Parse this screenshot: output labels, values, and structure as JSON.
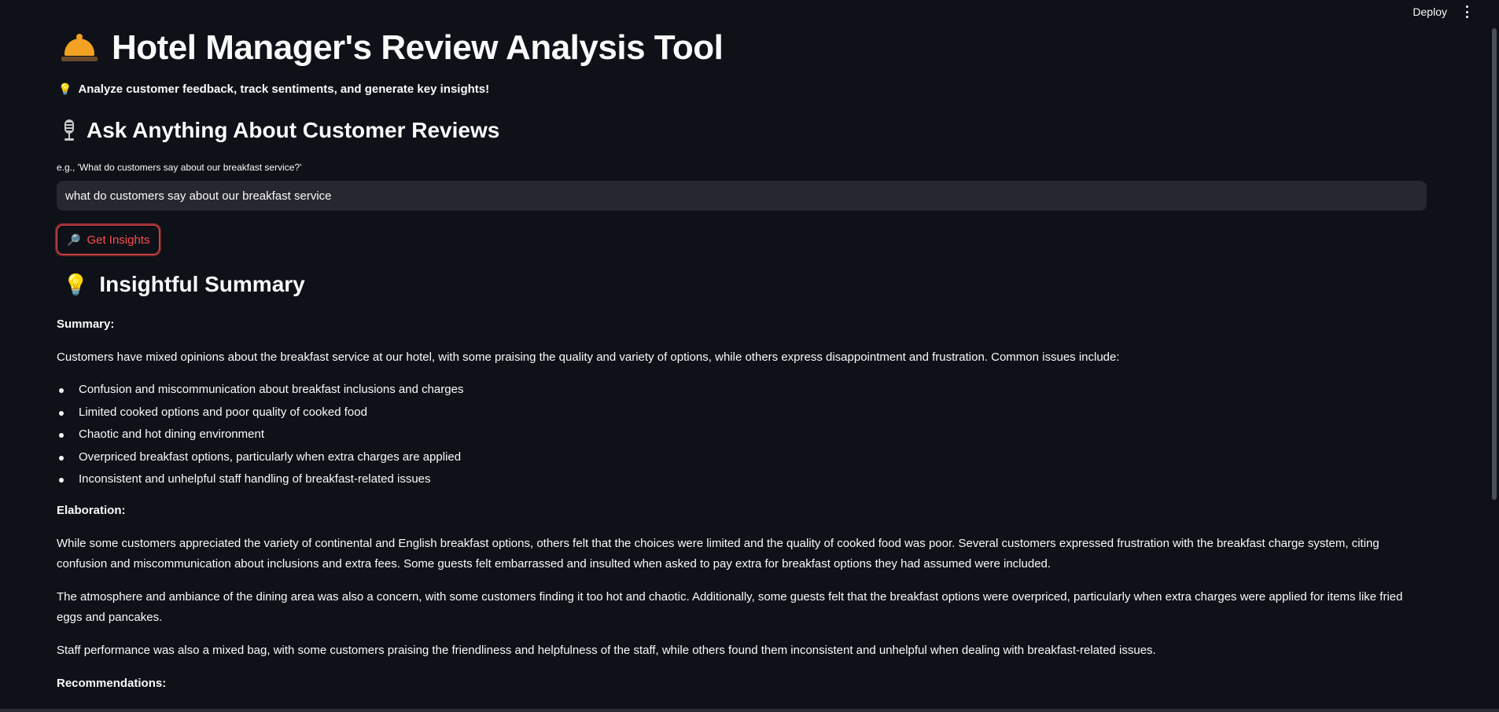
{
  "topbar": {
    "deploy_label": "Deploy"
  },
  "header": {
    "title": "Hotel Manager's Review Analysis Tool",
    "tagline": "Analyze customer feedback, track sentiments, and generate key insights!"
  },
  "ask": {
    "heading": "Ask Anything About Customer Reviews",
    "field_label": "e.g., 'What do customers say about our breakfast service?'",
    "input_value": "what do customers say about our breakfast service",
    "button_label": "Get Insights"
  },
  "summary": {
    "heading": "Insightful Summary",
    "summary_label": "Summary:",
    "intro": "Customers have mixed opinions about the breakfast service at our hotel, with some praising the quality and variety of options, while others express disappointment and frustration. Common issues include:",
    "issues": [
      "Confusion and miscommunication about breakfast inclusions and charges",
      "Limited cooked options and poor quality of cooked food",
      "Chaotic and hot dining environment",
      "Overpriced breakfast options, particularly when extra charges are applied",
      "Inconsistent and unhelpful staff handling of breakfast-related issues"
    ],
    "elaboration_label": "Elaboration:",
    "paragraphs": [
      "While some customers appreciated the variety of continental and English breakfast options, others felt that the choices were limited and the quality of cooked food was poor. Several customers expressed frustration with the breakfast charge system, citing confusion and miscommunication about inclusions and extra fees. Some guests felt embarrassed and insulted when asked to pay extra for breakfast options they had assumed were included.",
      "The atmosphere and ambiance of the dining area was also a concern, with some customers finding it too hot and chaotic. Additionally, some guests felt that the breakfast options were overpriced, particularly when extra charges were applied for items like fried eggs and pancakes.",
      "Staff performance was also a mixed bag, with some customers praising the friendliness and helpfulness of the staff, while others found them inconsistent and unhelpful when dealing with breakfast-related issues."
    ],
    "recommendations_label": "Recommendations:"
  }
}
